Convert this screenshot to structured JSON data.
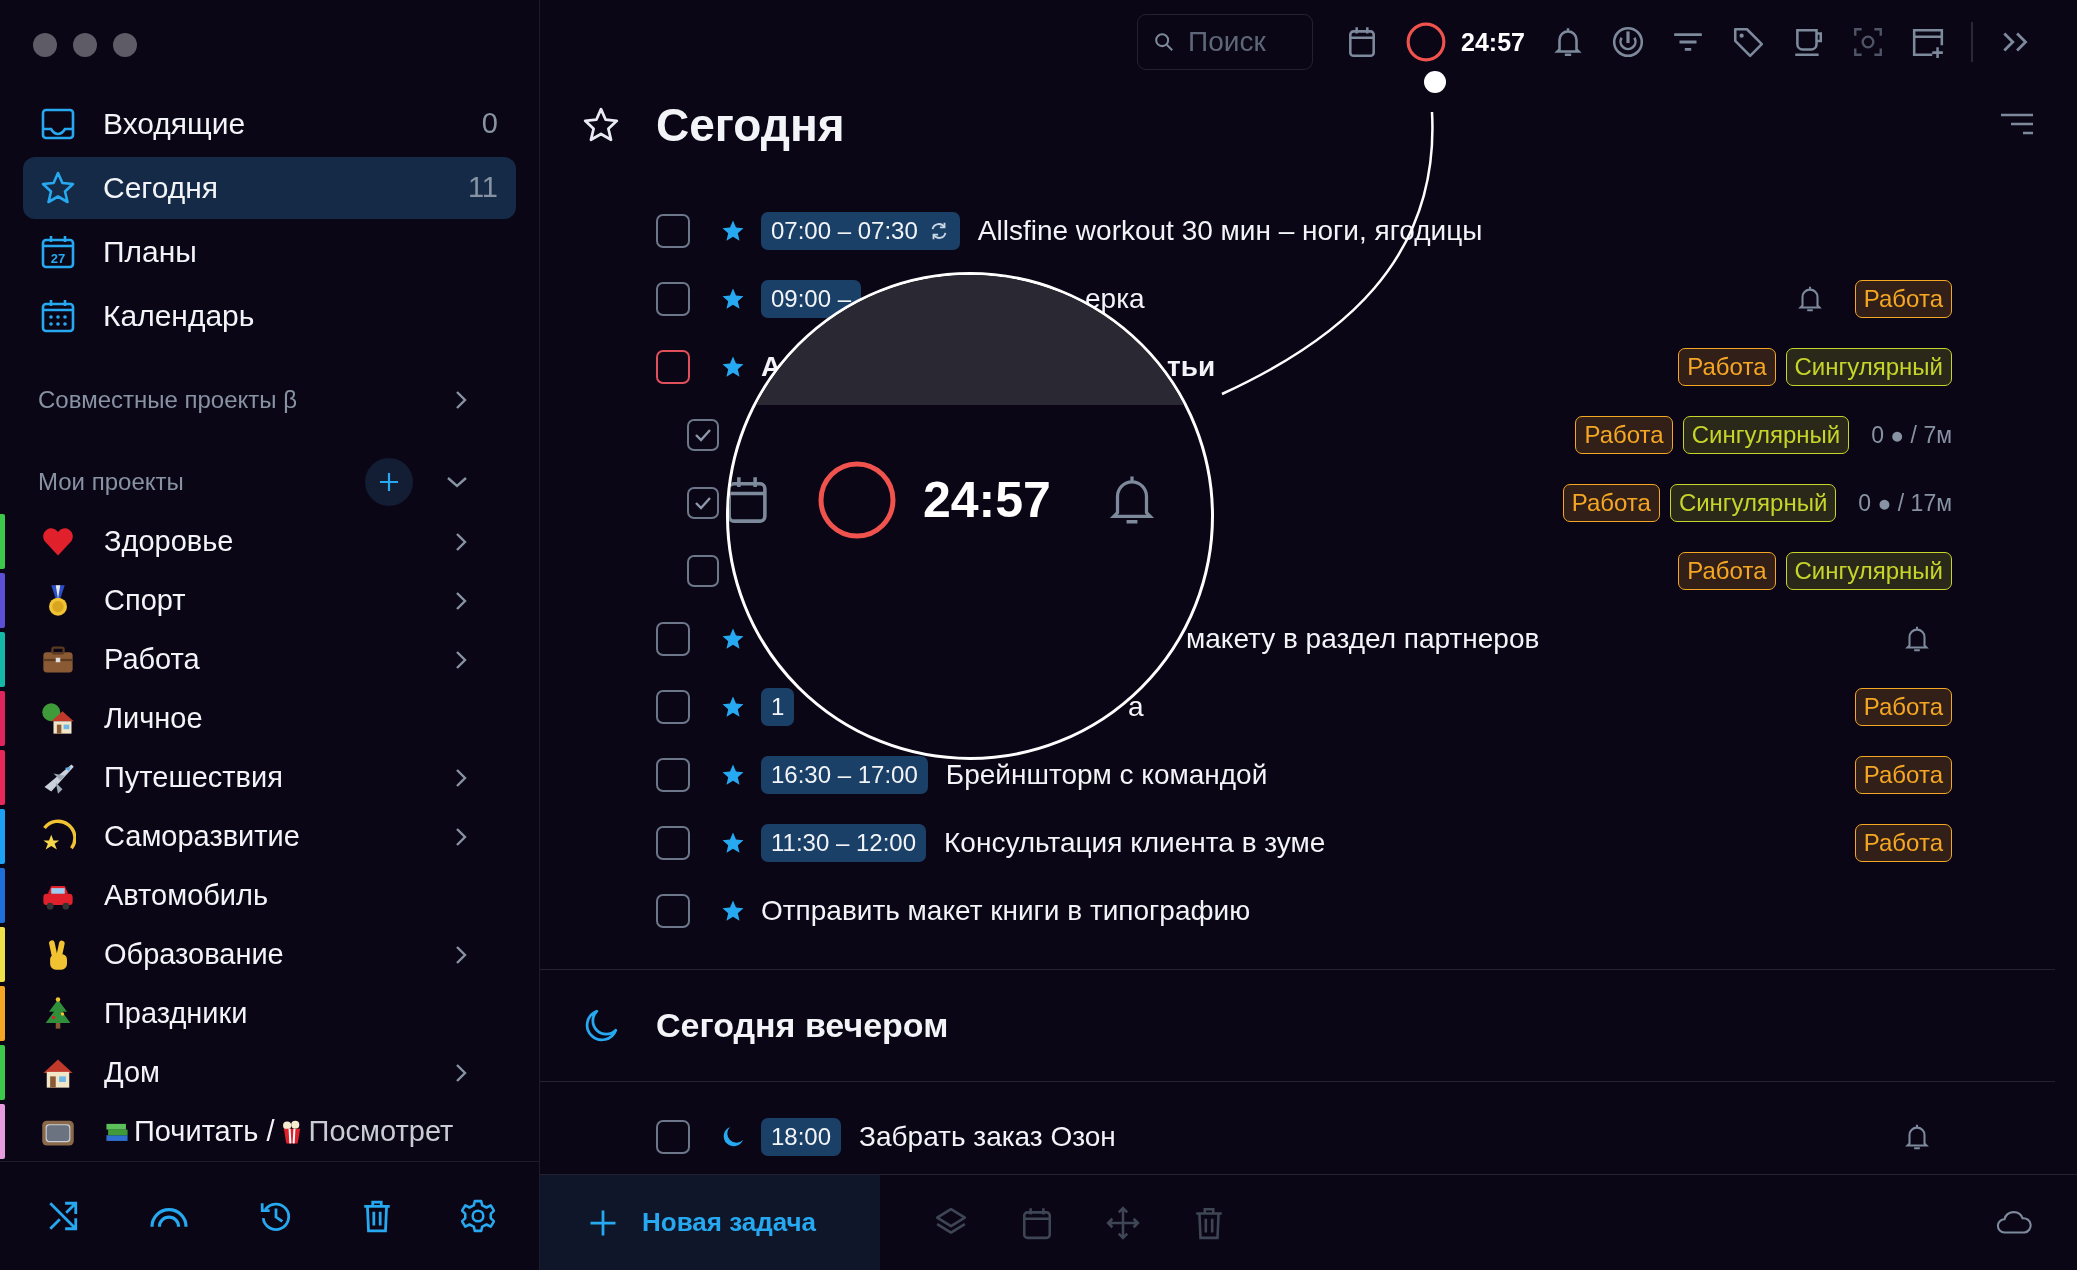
{
  "sidebar": {
    "nav": [
      {
        "label": "Входящие",
        "count": "0",
        "selected": false
      },
      {
        "label": "Сегодня",
        "count": "11",
        "selected": true
      },
      {
        "label": "Планы",
        "icon_label": "27",
        "selected": false
      },
      {
        "label": "Календарь",
        "selected": false
      }
    ],
    "shared": {
      "label": "Совместные проекты β"
    },
    "projects_header": {
      "label": "Мои проекты"
    },
    "projects": [
      {
        "label": "Здоровье",
        "color": "#3cc84a",
        "expandable": true
      },
      {
        "label": "Спорт",
        "color": "#5b4fd6",
        "expandable": true
      },
      {
        "label": "Работа",
        "color": "#14b8a6",
        "expandable": true
      },
      {
        "label": "Личное",
        "color": "#e0245e",
        "expandable": false
      },
      {
        "label": "Путешествия",
        "color": "#e8285a",
        "expandable": true
      },
      {
        "label": "Саморазвитие",
        "color": "#1da1f2",
        "expandable": true
      },
      {
        "label": "Автомобиль",
        "color": "#1e6fd9",
        "expandable": false
      },
      {
        "label": "Образование",
        "color": "#f0e04a",
        "expandable": true
      },
      {
        "label": "Праздники",
        "color": "#f5a623",
        "expandable": false
      },
      {
        "label": "Дом",
        "color": "#3cc84a",
        "expandable": true
      },
      {
        "label_parts": [
          "Почитать /",
          "Посмотрет"
        ],
        "color": "#e89ce0",
        "expandable": false
      }
    ]
  },
  "topbar": {
    "search": {
      "placeholder": "Поиск"
    },
    "timer": "24:57"
  },
  "sections": [
    {
      "title": "Сегодня",
      "tasks": [
        {
          "checked": false,
          "flagged": false,
          "kind": "star",
          "time": "07:00 – 07:30",
          "repeat": true,
          "title": "Allsfine workout 30 мин – ноги, ягодицы"
        },
        {
          "checked": false,
          "flagged": false,
          "kind": "star",
          "time": "09:00 –",
          "tail": "ерка",
          "reminder": true,
          "tags": [
            {
              "label": "Работа",
              "color": "#f5a623"
            }
          ]
        },
        {
          "checked": false,
          "flagged": true,
          "kind": "star",
          "title": "А",
          "tail": "тьи",
          "bold": true,
          "tags": [
            {
              "label": "Работа",
              "color": "#f5a623"
            },
            {
              "label": "Сингулярный",
              "color": "#c6d52a"
            }
          ],
          "children": [
            {
              "checked": true,
              "flagged": false,
              "tags": [
                {
                  "label": "Работа",
                  "color": "#f5a623"
                },
                {
                  "label": "Сингулярный",
                  "color": "#c6d52a"
                }
              ],
              "progress": "0 ● / 7м"
            },
            {
              "checked": true,
              "flagged": false,
              "tags": [
                {
                  "label": "Работа",
                  "color": "#f5a623"
                },
                {
                  "label": "Сингулярный",
                  "color": "#c6d52a"
                }
              ],
              "progress": "0 ● / 17м"
            },
            {
              "checked": false,
              "flagged": false,
              "tags": [
                {
                  "label": "Работа",
                  "color": "#f5a623"
                },
                {
                  "label": "Сингулярный",
                  "color": "#c6d52a"
                }
              ]
            }
          ]
        },
        {
          "checked": false,
          "flagged": false,
          "kind": "star",
          "tail": "макету в раздел партнеров",
          "reminder": true
        },
        {
          "checked": false,
          "flagged": false,
          "kind": "star",
          "time": "1",
          "tail": "а",
          "tags": [
            {
              "label": "Работа",
              "color": "#f5a623"
            }
          ]
        },
        {
          "checked": false,
          "flagged": false,
          "kind": "star",
          "time": "16:30 – 17:00",
          "title": "Брейншторм с командой",
          "tags": [
            {
              "label": "Работа",
              "color": "#f5a623"
            }
          ]
        },
        {
          "checked": false,
          "flagged": false,
          "kind": "star",
          "time": "11:30 – 12:00",
          "title": "Консультация клиента в зуме",
          "tags": [
            {
              "label": "Работа",
              "color": "#f5a623"
            }
          ]
        },
        {
          "checked": false,
          "flagged": false,
          "kind": "star",
          "title": "Отправить макет книги в типографию"
        }
      ]
    },
    {
      "title": "Сегодня вечером",
      "tasks": [
        {
          "checked": false,
          "flagged": false,
          "kind": "moon",
          "time": "18:00",
          "title": "Забрать заказ Озон",
          "reminder": true
        }
      ]
    }
  ],
  "magnifier": {
    "time": "24:57"
  },
  "bottom_bar": {
    "new_task": "Новая задача"
  }
}
